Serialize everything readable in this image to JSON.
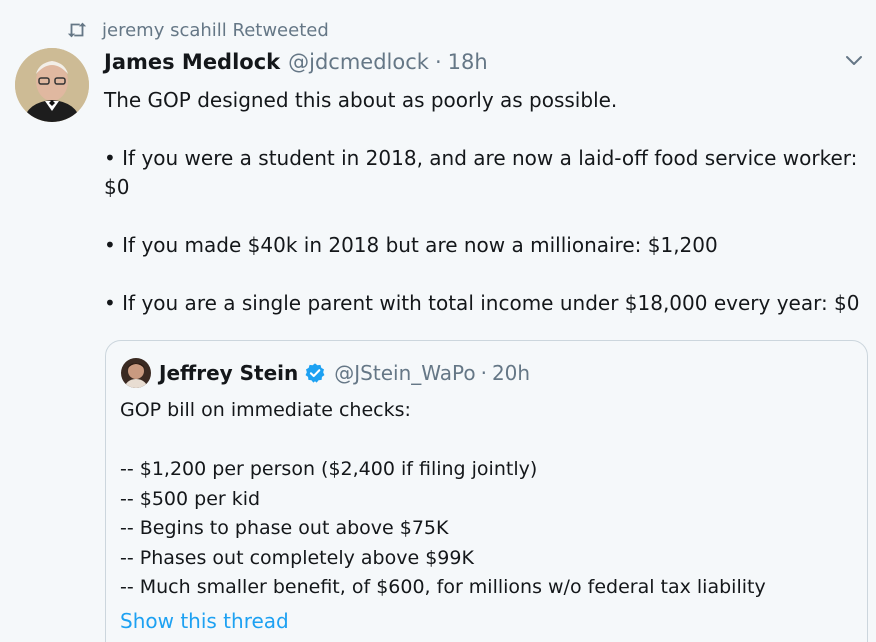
{
  "retweet": {
    "icon": "retweet-icon",
    "label": "jeremy scahill Retweeted"
  },
  "tweet": {
    "author": {
      "name": "James Medlock",
      "handle": "@jdcmedlock",
      "avatar_icon": "profile-photo"
    },
    "dot": "·",
    "time": "18h",
    "text": "The GOP designed this about as poorly as possible.\n\n• If you were a student in 2018, and are now a laid-off food service worker: $0\n\n• If you made $40k in 2018 but are now a millionaire: $1,200\n\n• If you are a single parent with total income under $18,000 every year: $0",
    "menu_icon": "chevron-down-icon"
  },
  "quote": {
    "author": {
      "name": "Jeffrey Stein",
      "handle": "@JStein_WaPo",
      "verified": true,
      "avatar_icon": "profile-photo"
    },
    "dot": "·",
    "time": "20h",
    "text": "GOP bill on immediate checks:\n\n-- $1,200 per person ($2,400 if filing jointly)\n-- $500 per kid\n-- Begins to phase out above $75K\n-- Phases out completely above $99K\n-- Much smaller benefit, of $600, for millions w/o federal tax liability",
    "show_thread": "Show this thread"
  },
  "colors": {
    "background": "#f5f8fa",
    "text": "#14171a",
    "muted": "#657786",
    "link": "#1da1f2",
    "border": "#ccd6dd",
    "verified": "#1da1f2"
  }
}
